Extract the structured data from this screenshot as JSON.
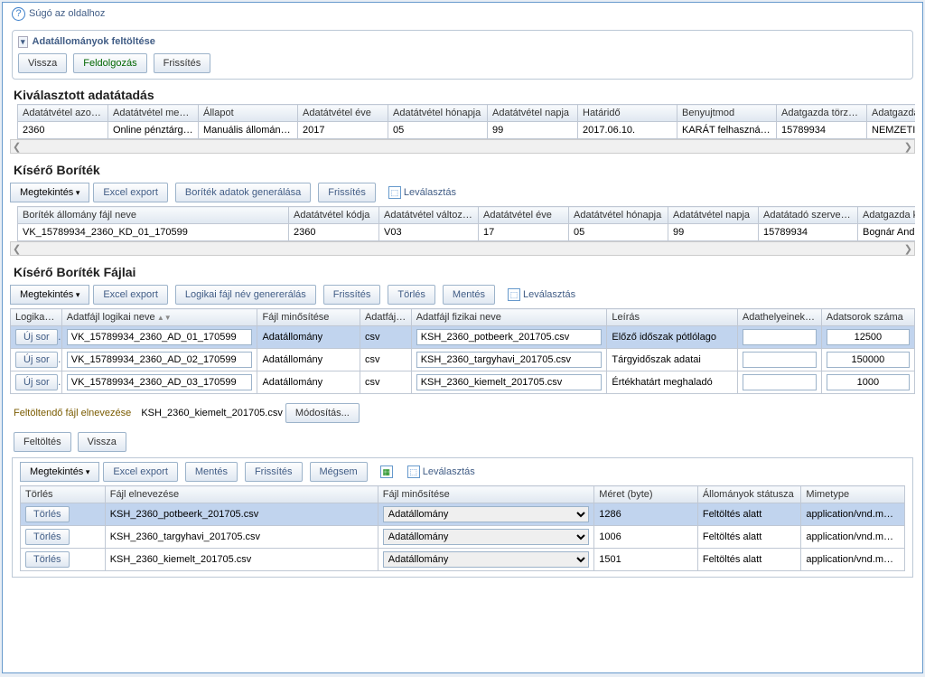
{
  "help": "Súgó az oldalhoz",
  "panel_title": "Adatállományok feltöltése",
  "buttons": {
    "vissza": "Vissza",
    "feldolgozas": "Feldolgozás",
    "frissites": "Frissítés",
    "megtekintes": "Megtekintés",
    "excel": "Excel export",
    "boritek_gen": "Boríték adatok generálása",
    "levalasztas": "Leválasztás",
    "logikai_gen": "Logikai fájl név genererálás",
    "torles": "Törlés",
    "mentes": "Mentés",
    "uj_sor": "Új sor",
    "modositas": "Módosítás...",
    "feltoltes": "Feltöltés",
    "megsem": "Mégsem"
  },
  "sec1": {
    "title": "Kiválasztott adatátadás",
    "headers": [
      "Adatátvétel azonosítója",
      "Adatátvétel megnevezése",
      "Állapot",
      "Adatátvétel éve",
      "Adatátvétel hónapja",
      "Adatátvétel napja",
      "Határidő",
      "Benyujtmod",
      "Adatgazda törzsszáma",
      "Adatgazda"
    ],
    "row": [
      "2360",
      "Online pénztárgép…",
      "Manuális állomány…",
      "2017",
      "05",
      "99",
      "2017.06.10.",
      "KARÁT felhasználó…",
      "15789934",
      "NEMZETI A"
    ]
  },
  "sec2": {
    "title": "Kísérő Boríték",
    "headers": [
      "Boríték állomány fájl neve",
      "Adatátvétel kódja",
      "Adatátvétel változat azonosító",
      "Adatátvétel éve",
      "Adatátvétel hónapja",
      "Adatátvétel napja",
      "Adatátadó szervezet törzsszám",
      "Adatgazda kapcsolattart"
    ],
    "row": [
      "VK_15789934_2360_KD_01_170599",
      "2360",
      "V03",
      "17",
      "05",
      "99",
      "15789934",
      "Bognár Andr"
    ]
  },
  "sec3": {
    "title": "Kísérő Boríték Fájlai",
    "headers": [
      "Logikai fájlnév másolása",
      "Adatfájl logikai neve",
      "Fájl minősítése",
      "Adatfájlok típusa",
      "Adatfájl fizikai neve",
      "Leírás",
      "Adathelyeinek száma",
      "Adatsorok száma"
    ],
    "rows": [
      {
        "log": "VK_15789934_2360_AD_01_170599",
        "min": "Adatállomány",
        "tip": "csv",
        "fiz": "KSH_2360_potbeerk_201705.csv",
        "leir": "Előző időszak pótlólago",
        "szam": "12500",
        "sel": true
      },
      {
        "log": "VK_15789934_2360_AD_02_170599",
        "min": "Adatállomány",
        "tip": "csv",
        "fiz": "KSH_2360_targyhavi_201705.csv",
        "leir": "Tárgyidőszak adatai",
        "szam": "150000"
      },
      {
        "log": "VK_15789934_2360_AD_03_170599",
        "min": "Adatállomány",
        "tip": "csv",
        "fiz": "KSH_2360_kiemelt_201705.csv",
        "leir": "Értékhatárt meghaladó",
        "szam": "1000"
      }
    ]
  },
  "detail": {
    "label": "Feltöltendő fájl elnevezése",
    "value": "KSH_2360_kiemelt_201705.csv"
  },
  "sec4": {
    "headers": [
      "Törlés",
      "Fájl elnevezése",
      "Fájl minősítése",
      "Méret (byte)",
      "Állományok státusza",
      "Mimetype"
    ],
    "rows": [
      {
        "fn": "KSH_2360_potbeerk_201705.csv",
        "min": "Adatállomány",
        "size": "1286",
        "stat": "Feltöltés alatt",
        "mime": "application/vnd.m…",
        "sel": true
      },
      {
        "fn": "KSH_2360_targyhavi_201705.csv",
        "min": "Adatállomány",
        "size": "1006",
        "stat": "Feltöltés alatt",
        "mime": "application/vnd.m…"
      },
      {
        "fn": "KSH_2360_kiemelt_201705.csv",
        "min": "Adatállomány",
        "size": "1501",
        "stat": "Feltöltés alatt",
        "mime": "application/vnd.m…"
      }
    ]
  }
}
